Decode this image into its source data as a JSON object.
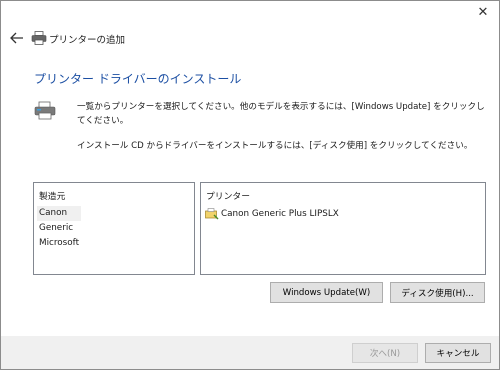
{
  "window": {
    "title": "プリンターの追加",
    "close_glyph": "✕"
  },
  "page": {
    "heading": "プリンター ドライバーのインストール",
    "instruction1": "一覧からプリンターを選択してください。他のモデルを表示するには、[Windows Update] をクリックしてください。",
    "instruction2": "インストール CD からドライバーをインストールするには、[ディスク使用] をクリックしてください。"
  },
  "manufacturers": {
    "header": "製造元",
    "items": [
      "Canon",
      "Generic",
      "Microsoft"
    ],
    "selected": "Canon"
  },
  "printers": {
    "header": "プリンター",
    "items": [
      "Canon Generic Plus LIPSLX"
    ]
  },
  "buttons": {
    "windows_update": "Windows Update(W)",
    "have_disk": "ディスク使用(H)...",
    "next": "次へ(N)",
    "cancel": "キャンセル"
  },
  "icons": {
    "back": "back-arrow-icon",
    "title_printer": "printer-icon",
    "large_printer": "printer-install-icon",
    "printer_item": "printer-driver-icon"
  }
}
